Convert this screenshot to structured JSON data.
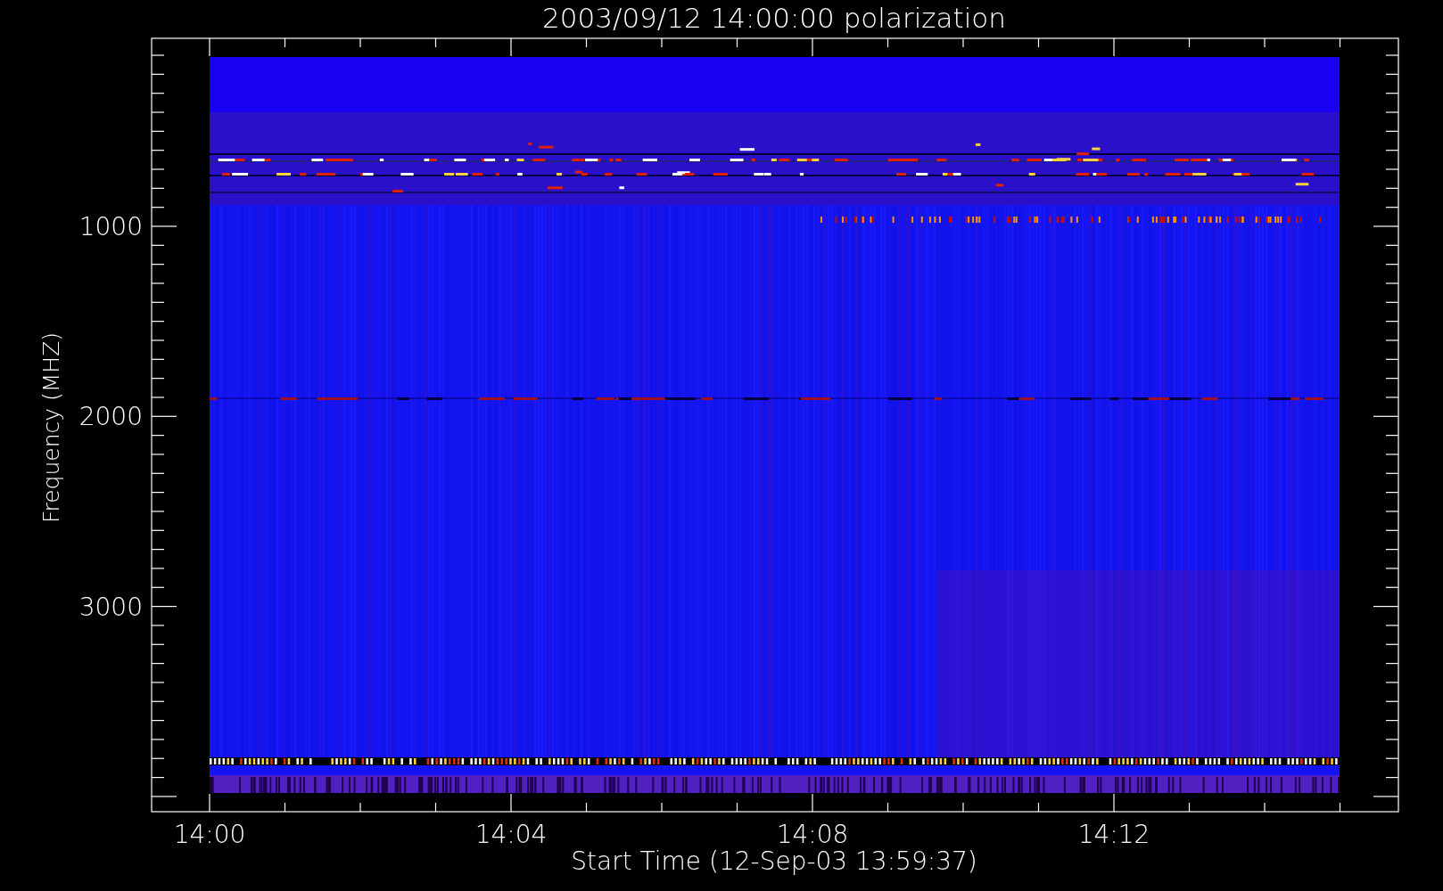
{
  "plot": {
    "title": "2003/09/12 14:00:00 polarization",
    "ylabel": "Frequency (MHZ)",
    "xlabel": "Start Time (12-Sep-03 13:59:37)",
    "yticks": [
      "1000",
      "2000",
      "3000"
    ],
    "xticks": [
      "14:00",
      "14:04",
      "14:08",
      "14:12"
    ]
  }
}
